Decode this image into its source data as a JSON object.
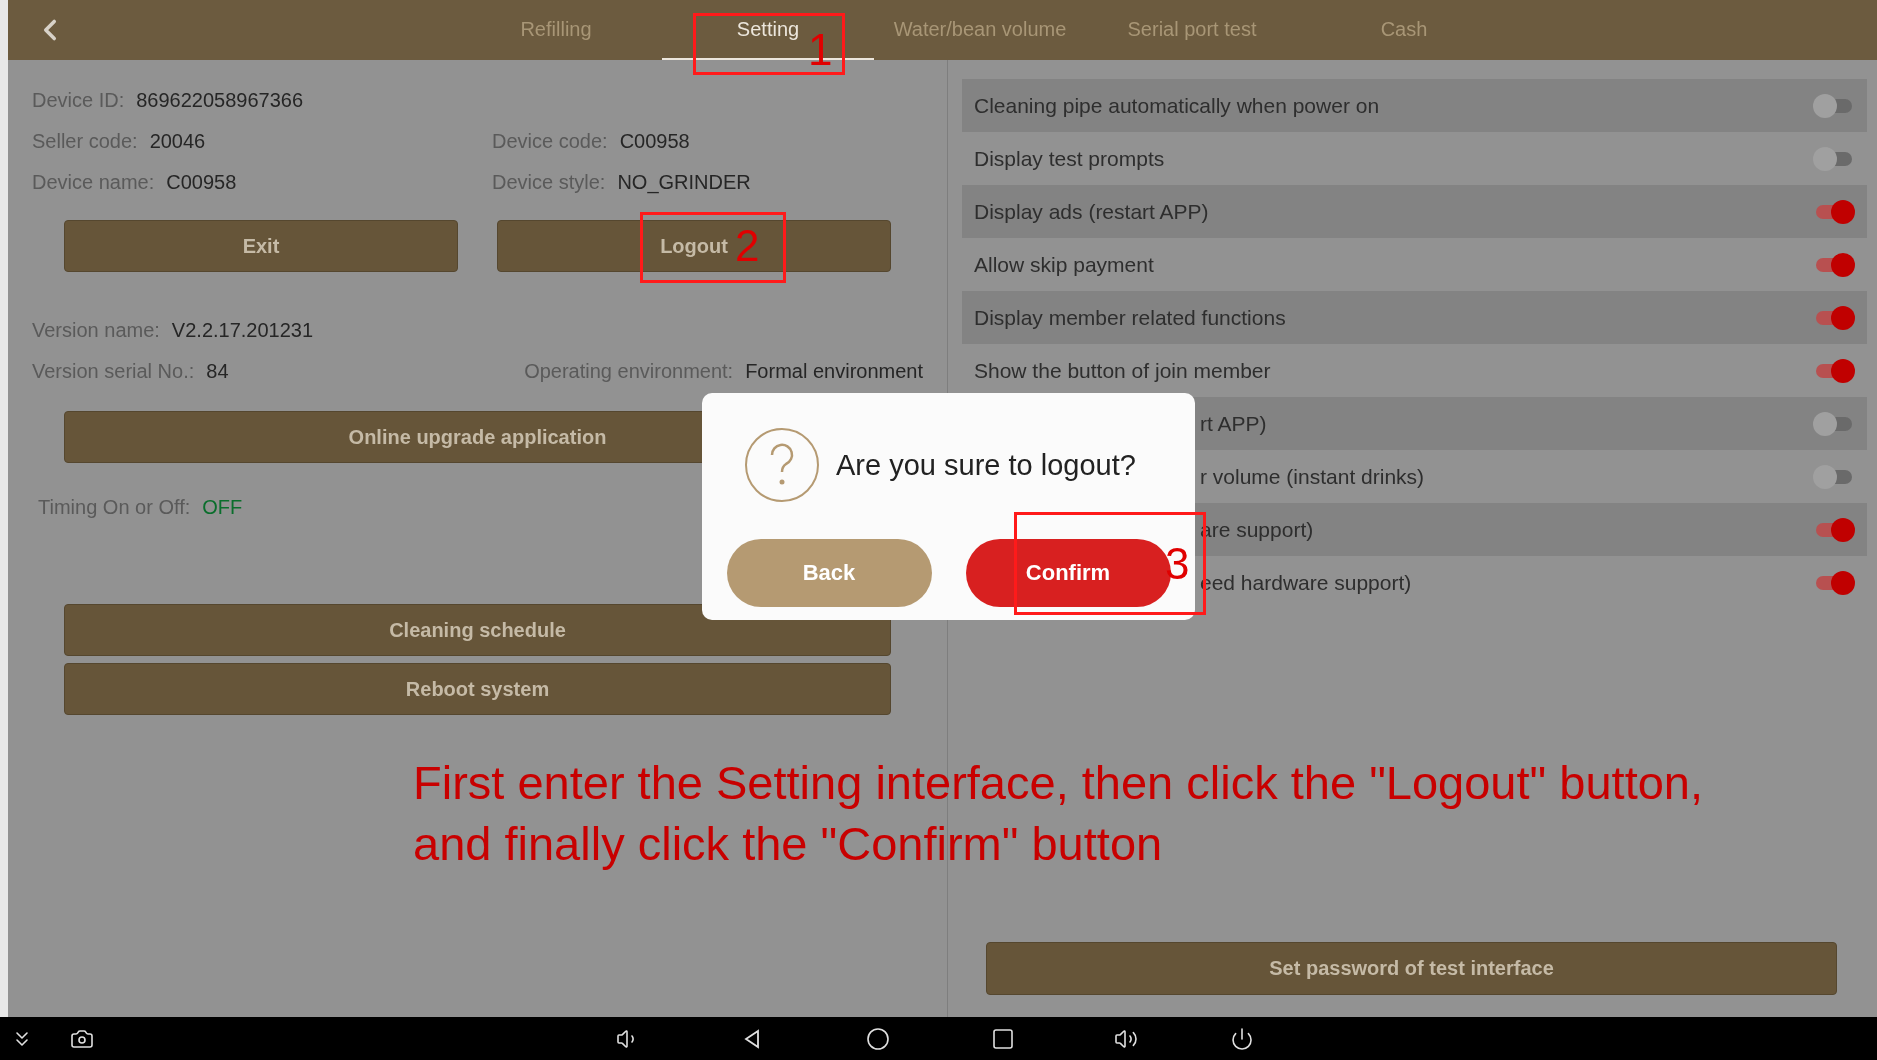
{
  "top_bar": {
    "tabs": [
      {
        "label": "Refilling",
        "selected": false
      },
      {
        "label": "Setting",
        "selected": true
      },
      {
        "label": "Water/bean volume",
        "selected": false
      },
      {
        "label": "Serial port test",
        "selected": false
      },
      {
        "label": "Cash",
        "selected": false
      }
    ]
  },
  "info_rows": [
    {
      "fields": [
        {
          "label": "Device ID:",
          "value": "869622058967366"
        }
      ]
    },
    {
      "fields": [
        {
          "label": "Seller code:",
          "value": "20046"
        },
        {
          "label": "Device code:",
          "value": "C00958"
        }
      ]
    },
    {
      "fields": [
        {
          "label": "Device name:",
          "value": "C00958"
        },
        {
          "label": "Device style:",
          "value": "NO_GRINDER"
        }
      ]
    }
  ],
  "account_buttons": [
    "Exit",
    "Logout"
  ],
  "version_rows": [
    {
      "fields": [
        {
          "label": "Version name:",
          "value": "V2.2.17.201231"
        }
      ]
    },
    {
      "fields": [
        {
          "label": "Version serial No.:",
          "value": "84"
        },
        {
          "label": "Operating environment:",
          "value": "Formal environment"
        }
      ]
    }
  ],
  "upgrade_button": "Online upgrade application",
  "timing": {
    "label": "Timing On or Off:",
    "value": "OFF"
  },
  "maintenance_buttons": [
    "Cleaning schedule",
    "Reboot system"
  ],
  "settings": [
    {
      "label": "Cleaning pipe automatically when power on",
      "on": false
    },
    {
      "label": "Display test prompts",
      "on": false
    },
    {
      "label": "Display ads (restart APP)",
      "on": true
    },
    {
      "label": "Allow skip payment",
      "on": true
    },
    {
      "label": "Display member related functions",
      "on": true
    },
    {
      "label": "Show the button of join member",
      "on": true
    },
    {
      "label": "rt APP)",
      "on": false,
      "kind": "covered"
    },
    {
      "label": "r volume (instant drinks)",
      "on": false,
      "kind": "covered"
    },
    {
      "label": "are support)",
      "on": true,
      "kind": "covered"
    },
    {
      "label": "eed hardware support)",
      "on": true,
      "kind": "covered"
    }
  ],
  "password_button": "Set password of test interface",
  "dialog": {
    "message": "Are you sure to logout?",
    "buttons": [
      {
        "label": "Back",
        "kind": "secondary"
      },
      {
        "label": "Confirm",
        "kind": "primary"
      }
    ]
  },
  "annotations": {
    "markers": [
      "1",
      "2",
      "3"
    ],
    "instruction": "First enter the Setting interface, then click the \"Logout\" button, and finally click the \"Confirm\" button"
  }
}
